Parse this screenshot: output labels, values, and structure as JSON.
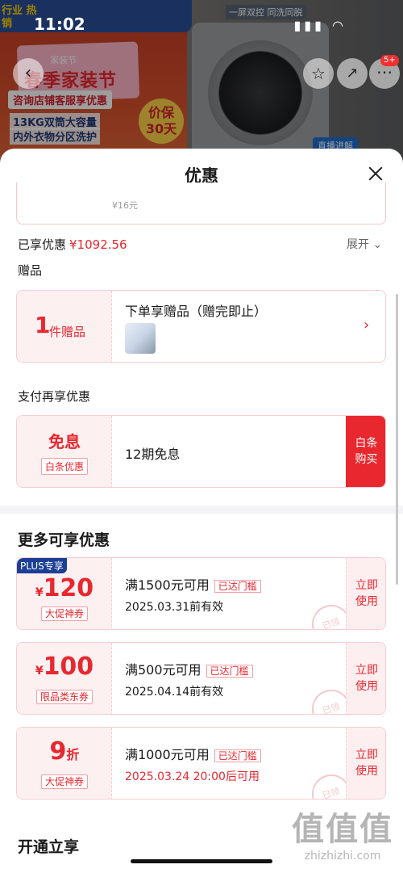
{
  "status_bar": {
    "time": "11:02"
  },
  "background": {
    "brand_tag": "行业 热销",
    "festival_small": "家装节",
    "festival_title": "春季家装节",
    "promo_line": "咨询店铺客服享优惠",
    "feature_line1": "13KG双筒大容量",
    "feature_line2": "内外衣物分区洗护",
    "badge": "价保 30天",
    "slogan": "一屏双控 同洗同脱",
    "live": "直播进解",
    "cart_badge": "5+"
  },
  "sheet": {
    "title": "优惠",
    "prev_price": "¥16元",
    "enjoyed_label": "已享优惠",
    "enjoyed_amount": "¥1092.56",
    "expand_label": "展开",
    "gift_section": "赠品",
    "gift": {
      "count": "1",
      "unit": "件赠品",
      "title": "下单享赠品（赠完即止）"
    },
    "pay_section": "支付再享优惠",
    "pay": {
      "free_label": "免息",
      "tag": "白条优惠",
      "text": "12期免息",
      "button": "白条\n购买"
    },
    "more_title": "更多可享优惠",
    "coupons": [
      {
        "plus_tag": "PLUS专享",
        "symbol": "¥",
        "amount": "120",
        "suffix": "",
        "type": "大促神券",
        "condition": "满1500元可用",
        "met": "已达门槛",
        "date": "2025.03.31前有效",
        "button": "立即\n使用",
        "stamp": "已领"
      },
      {
        "plus_tag": "",
        "symbol": "¥",
        "amount": "100",
        "suffix": "",
        "type": "限品类东券",
        "condition": "满500元可用",
        "met": "已达门槛",
        "date": "2025.04.14前有效",
        "button": "立即\n使用",
        "stamp": "已领"
      },
      {
        "plus_tag": "",
        "symbol": "",
        "amount": "9",
        "suffix": "折",
        "type": "大促神券",
        "condition": "满1000元可用",
        "met": "已达门槛",
        "date": "2025.03.24 20:00后可用",
        "button": "立即\n使用",
        "stamp": "已领"
      }
    ],
    "open_title": "开通立享"
  },
  "watermark": {
    "big": "值值值",
    "small": "zhizhizhi.com"
  },
  "colors": {
    "accent": "#e8272f",
    "plus": "#1c3f96",
    "card_bg": "#fdf0f1"
  }
}
